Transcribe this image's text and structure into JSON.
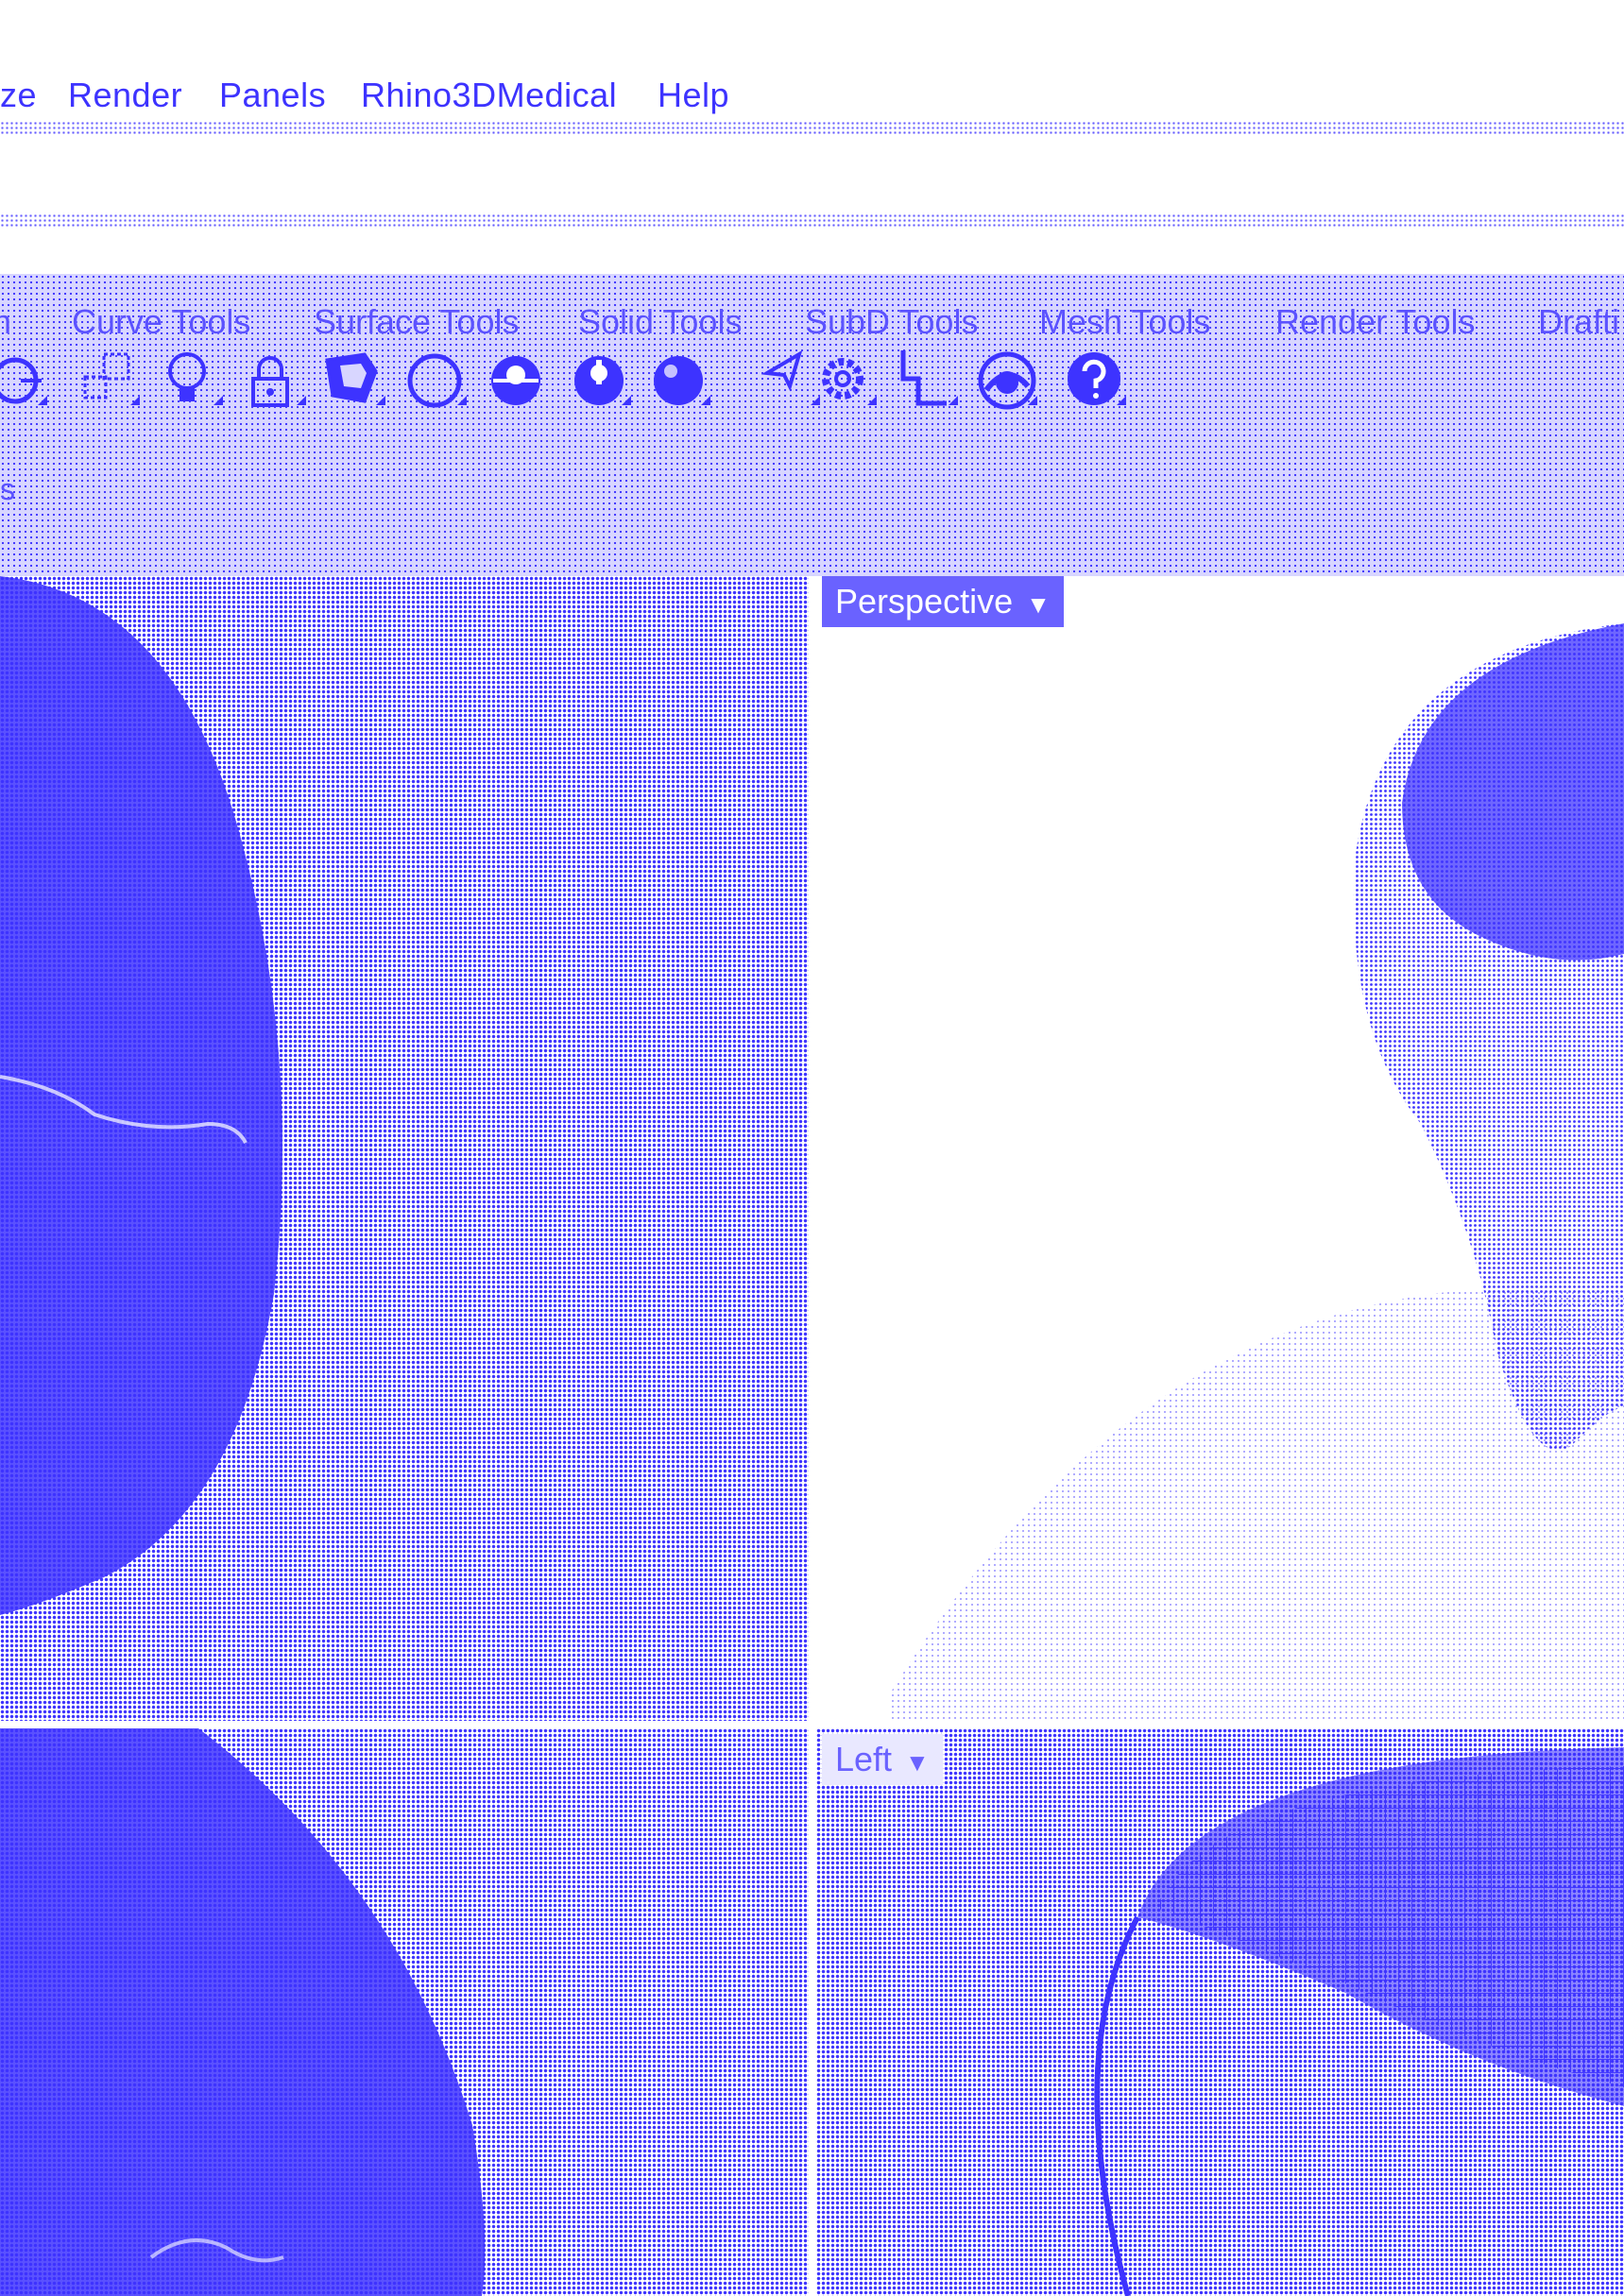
{
  "menu": {
    "items": [
      {
        "label": "ze"
      },
      {
        "label": "Render"
      },
      {
        "label": "Panels"
      },
      {
        "label": "Rhino3DMedical"
      },
      {
        "label": "Help"
      }
    ]
  },
  "ribbon": {
    "tabs": [
      {
        "label": "n"
      },
      {
        "label": "Curve Tools"
      },
      {
        "label": "Surface Tools"
      },
      {
        "label": "Solid Tools"
      },
      {
        "label": "SubD Tools"
      },
      {
        "label": "Mesh Tools"
      },
      {
        "label": "Render Tools"
      },
      {
        "label": "Drafti"
      }
    ],
    "row_label": "s",
    "tools": [
      {
        "icon": "move-object-icon"
      },
      {
        "icon": "scale-object-icon"
      },
      {
        "icon": "light-bulb-icon"
      },
      {
        "icon": "lock-icon"
      },
      {
        "icon": "shaded-shield-icon"
      },
      {
        "icon": "wireframe-sphere-icon"
      },
      {
        "icon": "rendered-sphere-icon"
      },
      {
        "icon": "cut-sphere-icon"
      },
      {
        "icon": "solid-sphere-icon"
      },
      {
        "icon": "pointer-icon"
      },
      {
        "icon": "gear-icon"
      },
      {
        "icon": "dimension-icon"
      },
      {
        "icon": "globe-icon"
      },
      {
        "icon": "help-icon"
      }
    ]
  },
  "viewports": {
    "perspective": {
      "title": "Perspective"
    },
    "left": {
      "title": "Left"
    }
  },
  "colors": {
    "accent": "#3d33ff",
    "background": "#ffffff"
  }
}
